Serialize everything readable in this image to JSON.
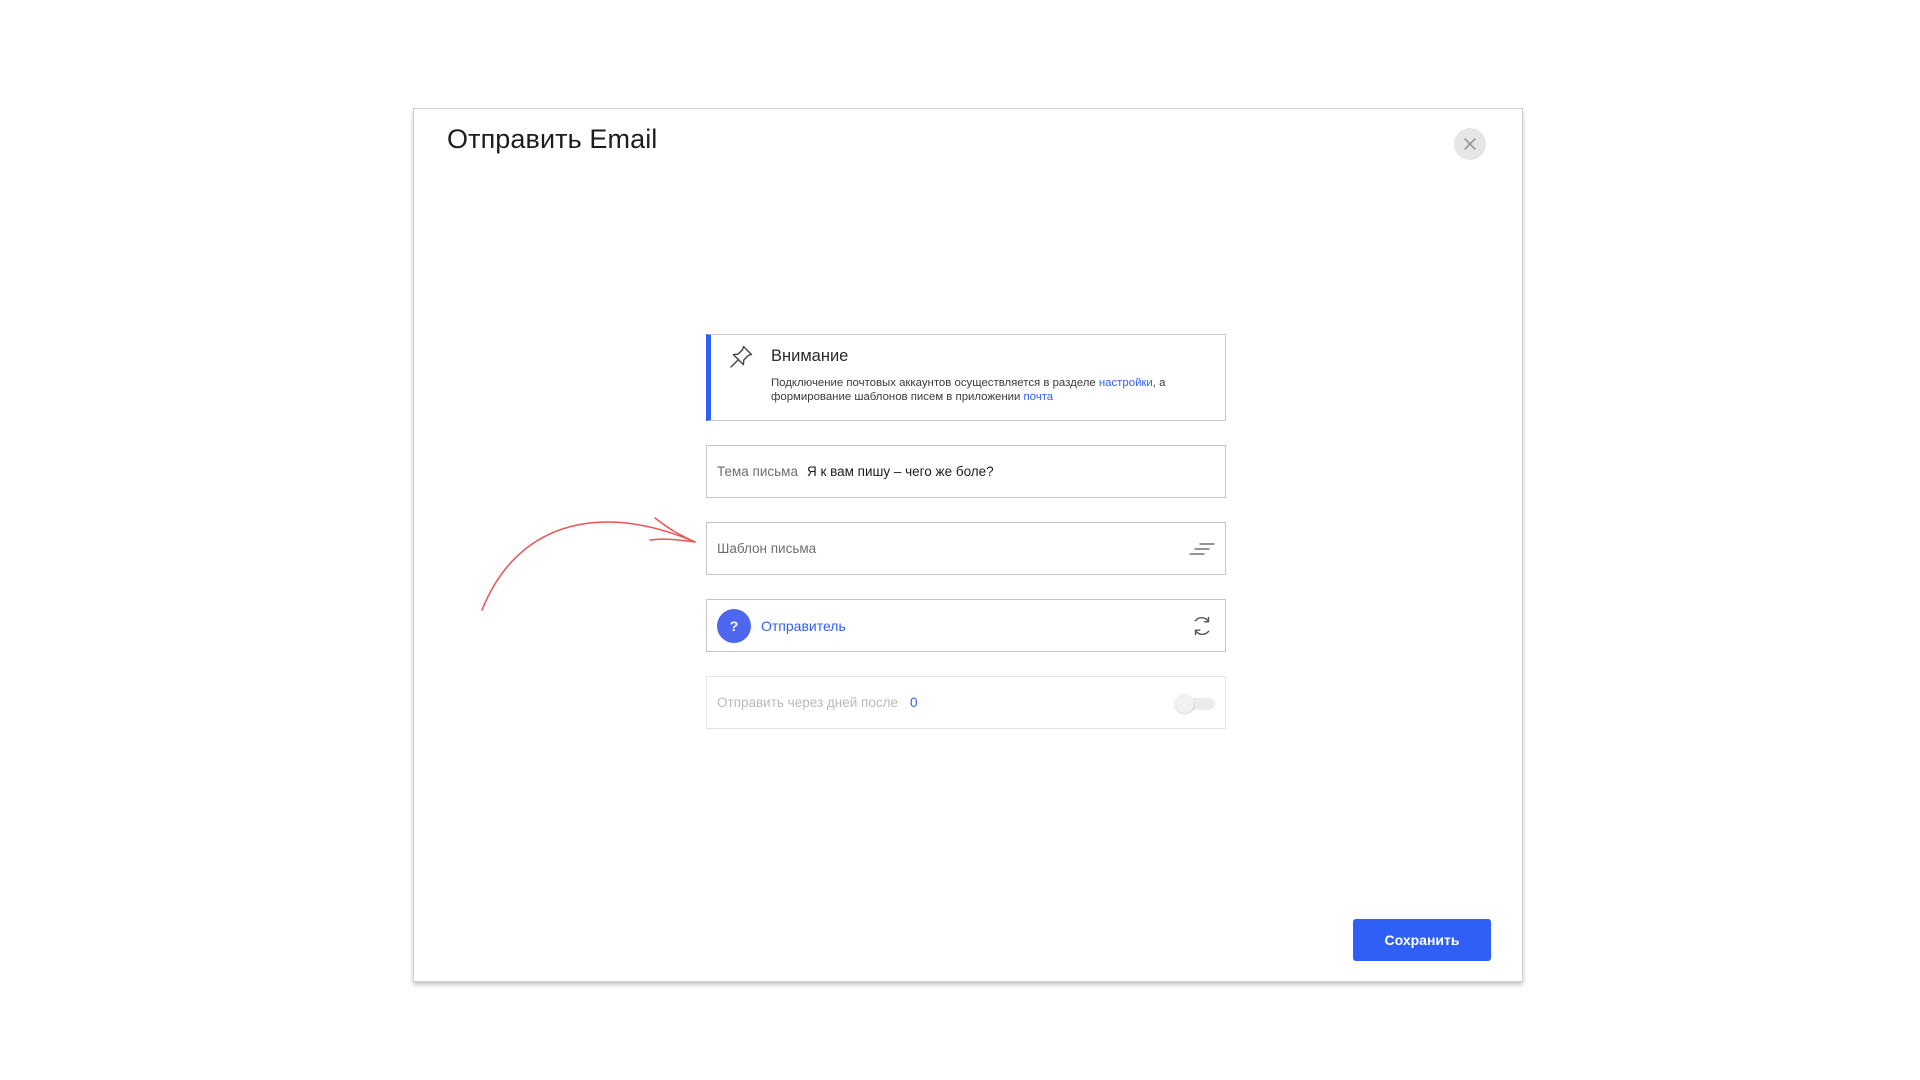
{
  "modal": {
    "title": "Отправить Email",
    "close_icon": "close-icon",
    "save_label": "Сохранить"
  },
  "notice": {
    "icon": "pin-icon",
    "title": "Внимание",
    "text_part1": "Подключение почтовых аккаунтов осуществляется в разделе ",
    "link_settings": "настройки",
    "text_part2": ", а формирование шаблонов писем в приложении ",
    "link_mail": "почта"
  },
  "fields": {
    "subject": {
      "label": "Тема письма",
      "value": "Я к вам пишу – чего же боле?"
    },
    "template": {
      "label": "Шаблон письма",
      "icon": "sort-lines-icon"
    },
    "sender": {
      "avatar_text": "?",
      "label": "Отправитель",
      "icon": "refresh-icon"
    },
    "send_after": {
      "label": "Отправить через дней после",
      "value": "0",
      "toggle_on": false
    }
  },
  "colors": {
    "accent": "#2f5ff5",
    "annotation": "#e85757"
  }
}
